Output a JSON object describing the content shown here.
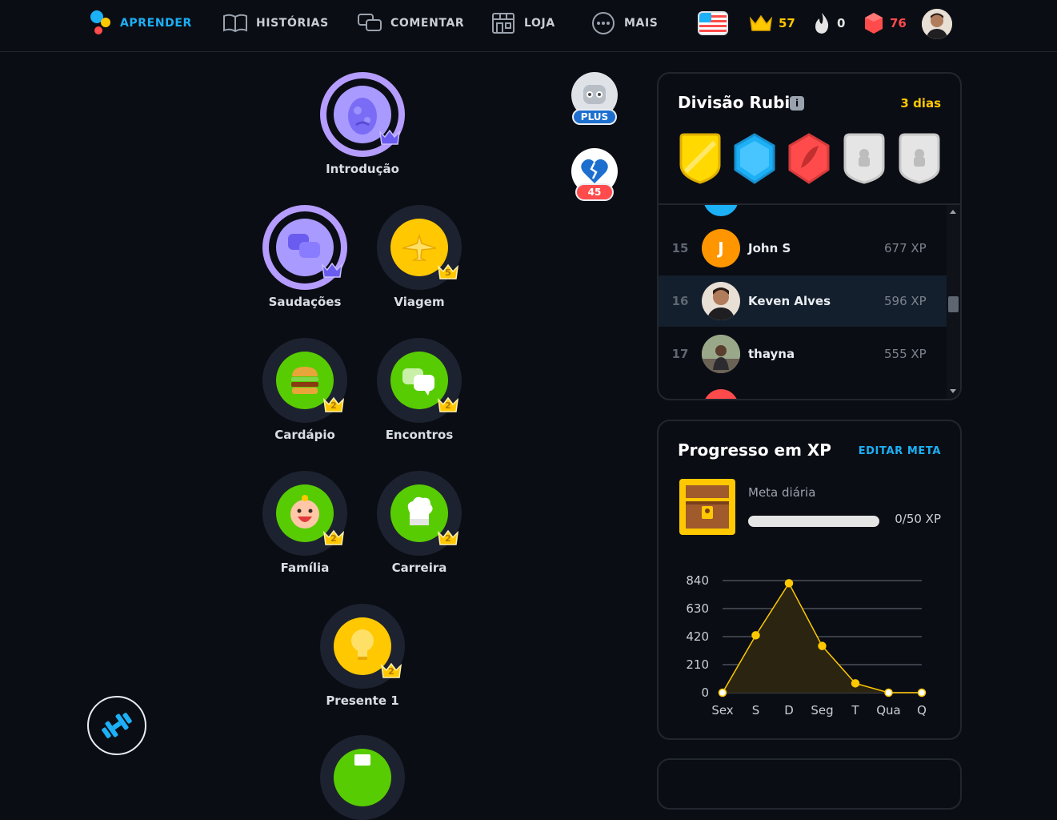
{
  "nav": {
    "items": [
      {
        "label": "APRENDER",
        "icon": "owl-logo-icon",
        "active": true
      },
      {
        "label": "HISTÓRIAS",
        "icon": "book-icon"
      },
      {
        "label": "COMENTAR",
        "icon": "chat-bubbles-icon"
      },
      {
        "label": "LOJA",
        "icon": "shop-icon"
      },
      {
        "label": "MAIS",
        "icon": "more-dots-icon"
      }
    ],
    "stats": {
      "crowns": "57",
      "streak": "0",
      "gems": "76"
    },
    "colors": {
      "active": "#1cb0f6",
      "crown": "#ffc800",
      "gem": "#ff4b4b"
    }
  },
  "path": {
    "nodes": [
      {
        "label": "Introdução",
        "badge": "",
        "icon": "egg-icon"
      },
      {
        "label": "Saudações",
        "badge": "",
        "icon": "speech-bubbles-icon"
      },
      {
        "label": "Viagem",
        "badge": "5",
        "icon": "airplane-icon"
      },
      {
        "label": "Cardápio",
        "badge": "2",
        "icon": "burger-icon"
      },
      {
        "label": "Encontros",
        "badge": "2",
        "icon": "chat-icon"
      },
      {
        "label": "Família",
        "badge": "2",
        "icon": "baby-icon"
      },
      {
        "label": "Carreira",
        "badge": "2",
        "icon": "chef-hat-icon"
      },
      {
        "label": "Presente 1",
        "badge": "2",
        "icon": "lightbulb-icon"
      }
    ]
  },
  "side_buttons": {
    "plus_label": "PLUS",
    "hearts_count": "45"
  },
  "league": {
    "title": "Divisão Rubi",
    "days_left": "3 dias",
    "rows": [
      {
        "rank": "15",
        "name": "John S",
        "xp": "677 XP",
        "initial": "J",
        "avatar_color": "#ff9600"
      },
      {
        "rank": "16",
        "name": "Keven Alves",
        "xp": "596 XP",
        "highlight": true
      },
      {
        "rank": "17",
        "name": "thayna",
        "xp": "555 XP"
      }
    ]
  },
  "xp_progress": {
    "title": "Progresso em XP",
    "edit_label": "EDITAR META",
    "goal_label": "Meta diária",
    "goal_value": "0/50 XP",
    "goal_fraction": 0
  },
  "chart_data": {
    "type": "line",
    "categories": [
      "Sex",
      "S",
      "D",
      "Seg",
      "T",
      "Qua",
      "Q"
    ],
    "values": [
      0,
      430,
      820,
      350,
      70,
      0,
      0
    ],
    "ylim": [
      0,
      840
    ],
    "yticks": [
      "840",
      "630",
      "420",
      "210",
      "0"
    ],
    "color": "#ffc800",
    "grid": true
  }
}
